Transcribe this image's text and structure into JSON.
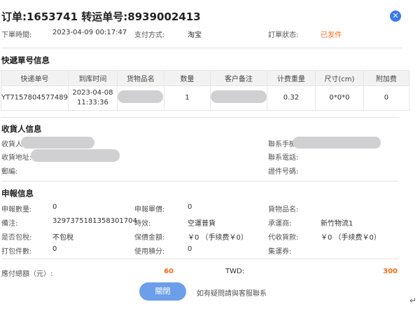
{
  "header": {
    "title": "订单:1653741 转运单号:8939002413",
    "close_icon": "close-circle-icon"
  },
  "order": {
    "time_label": "下單時間:",
    "time": "2023-04-09 00:17:47",
    "pay_label": "支付方式:",
    "pay": "淘宝",
    "status_label": "訂單狀态:",
    "status": "已发件",
    "status_color": "#f56c1a"
  },
  "express": {
    "title": "快遞單号信息",
    "columns": [
      "快递单号",
      "到库时间",
      "货物品名",
      "数量",
      "客户备注",
      "计费重量",
      "尺寸(cm)",
      "附加费"
    ],
    "rows": [
      {
        "no": "YT7157804577489",
        "date": "2023-04-08",
        "time": "11:33:36",
        "qty": "1",
        "weight": "0.32",
        "size": "0*0*0",
        "fee": "0"
      }
    ]
  },
  "receiver": {
    "title": "收貨人信息",
    "name_label": "收貨人:",
    "mobile_label": "聯系手機:",
    "address_label": "收貨地址:",
    "phone_label": "聯系電話:",
    "zip_label": "郵編:",
    "id_label": "證件号碼:"
  },
  "declare": {
    "title": "申報信息",
    "items": [
      {
        "label": "申報數量:",
        "value": "0"
      },
      {
        "label": "申報單價:",
        "value": "0"
      },
      {
        "label": "貨物品名:",
        "value": ""
      },
      {
        "label": "備注:",
        "value": "3297375181358301704"
      },
      {
        "label": "時效:",
        "value": "空運普貨"
      },
      {
        "label": "承運商:",
        "value": "新竹物流1"
      },
      {
        "label": "是否包稅:",
        "value": "不包稅"
      },
      {
        "label": "保價金額:",
        "value": "￥0 （手续费￥0）"
      },
      {
        "label": "代收貨款:",
        "value": "￥0 （手续费￥0）"
      },
      {
        "label": "打包件數:",
        "value": "0"
      },
      {
        "label": "使用積分:",
        "value": "0"
      },
      {
        "label": "集運券:",
        "value": ""
      }
    ]
  },
  "total": {
    "label": "應付總額（元）:",
    "value": "60",
    "twd_label": "TWD:",
    "twd": "300"
  },
  "footer": {
    "close_label": "關閉",
    "note": "如有疑問請與客服聯系",
    "accent": "#6c9eea"
  }
}
